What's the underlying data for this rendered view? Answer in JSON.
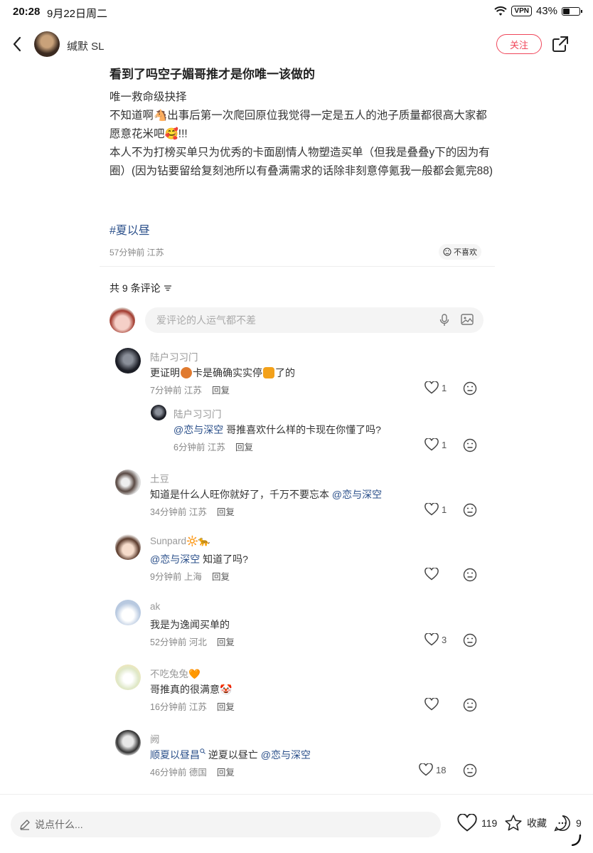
{
  "status": {
    "time": "20:28",
    "date": "9月22日周二",
    "vpn": "VPN",
    "battery": "43%",
    "battery_level": 0.43
  },
  "author": {
    "name": "缄默 SL",
    "follow": "关注"
  },
  "post": {
    "title": "看到了吗空子媚哥推才是你唯一该做的",
    "lines": [
      "唯一救命级抉择",
      "不知道啊🐴出事后第一次爬回原位我觉得一定是五人的池子质量都很高大家都愿意花米吧🥰!!!",
      "本人不为打榜买单只为优秀的卡面剧情人物塑造买单（但我是叠叠y下的因为有圈）(因为钻要留给复刻池所以有叠满需求的话除非刻意停氪我一般都会氪完88)"
    ],
    "hashtag": "#夏以昼",
    "meta": "57分钟前 江苏",
    "dislike": "不喜欢"
  },
  "comments_header": {
    "count": "共 9 条评论"
  },
  "comment_input": {
    "placeholder": "爱评论的人运气都不差"
  },
  "comments": [
    {
      "user": "陆户习习门",
      "pre": "更证明",
      "mid": "卡是确确实实停",
      "post": "了的",
      "meta": "7分钟前 江苏",
      "reply": "回复",
      "likes": "1"
    },
    {
      "user": "陆户习习门",
      "mention": "@恋与深空",
      "text": " 哥推喜欢什么样的卡现在你懂了吗?",
      "meta": "6分钟前 江苏",
      "reply": "回复",
      "likes": "1"
    },
    {
      "user": "土豆",
      "text": "知道是什么人旺你就好了，千万不要忘本 ",
      "mention": "@恋与深空",
      "meta": "34分钟前 江苏",
      "reply": "回复",
      "likes": "1"
    },
    {
      "user": "Sunpard🔆🐆",
      "mention": "@恋与深空",
      "text": " 知道了吗?",
      "meta": "9分钟前 上海",
      "reply": "回复",
      "likes": ""
    },
    {
      "user": "ak",
      "text": "我是为逸闻买单的",
      "meta": "52分钟前 河北",
      "reply": "回复",
      "likes": "3"
    },
    {
      "user": "不吃兔兔🧡",
      "text": "哥推真的很满意🤡",
      "meta": "16分钟前 江苏",
      "reply": "回复",
      "likes": ""
    },
    {
      "user": "阙",
      "mention1": "顺夏以昼昌",
      "text": " 逆夏以昼亡 ",
      "mention2": "@恋与深空",
      "meta": "46分钟前 德国",
      "reply": "回复",
      "likes": "18"
    }
  ],
  "bottom": {
    "say_placeholder": "说点什么...",
    "likes": "119",
    "collect": "收藏",
    "comments": "9"
  }
}
